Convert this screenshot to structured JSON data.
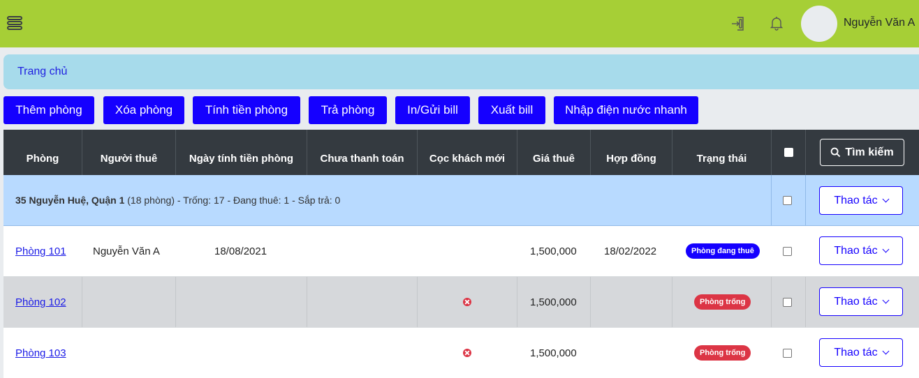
{
  "header": {
    "user_name": "Nguyễn Văn A",
    "icons": {
      "menu": "hamburger-menu-icon",
      "login": "login-icon",
      "notifications": "bell-icon"
    }
  },
  "breadcrumb": {
    "home": "Trang chủ"
  },
  "toolbar": {
    "add_room": "Thêm phòng",
    "delete_room": "Xóa phòng",
    "calc_rent": "Tính tiền phòng",
    "return_room": "Trả phòng",
    "print_send_bill": "In/Gửi bill",
    "export_bill": "Xuất bill",
    "quick_utilities": "Nhập điện nước nhanh"
  },
  "table": {
    "headers": {
      "room": "Phòng",
      "tenant": "Người thuê",
      "billing_date": "Ngày tính tiền phòng",
      "unpaid": "Chưa thanh toán",
      "new_deposit": "Cọc khách mới",
      "price": "Giá thuê",
      "contract": "Hợp đồng",
      "status": "Trạng thái"
    },
    "search_label": "Tìm kiếm",
    "group": {
      "name": "35 Nguyễn Huệ, Quận 1",
      "summary": " (18 phòng) - Trống: 17 - Đang thuê: 1 - Sắp trả: 0"
    },
    "action_label": "Thao tác",
    "rows": [
      {
        "room": "Phòng 101",
        "tenant": "Nguyễn Văn A",
        "billing_date": "18/08/2021",
        "unpaid": "",
        "deposit_missing": false,
        "price": "1,500,000",
        "contract": "18/02/2022",
        "status": "Phòng đang thuê"
      },
      {
        "room": "Phòng 102",
        "tenant": "",
        "billing_date": "",
        "unpaid": "",
        "deposit_missing": true,
        "price": "1,500,000",
        "contract": "",
        "status": "Phòng trống"
      },
      {
        "room": "Phòng 103",
        "tenant": "",
        "billing_date": "",
        "unpaid": "",
        "deposit_missing": true,
        "price": "1,500,000",
        "contract": "",
        "status": "Phòng trống"
      }
    ]
  },
  "colors": {
    "header_bg": "#a6cf36",
    "primary": "#1500ff",
    "danger": "#dc3545",
    "table_head": "#343a40",
    "group_row": "#b8daff"
  }
}
